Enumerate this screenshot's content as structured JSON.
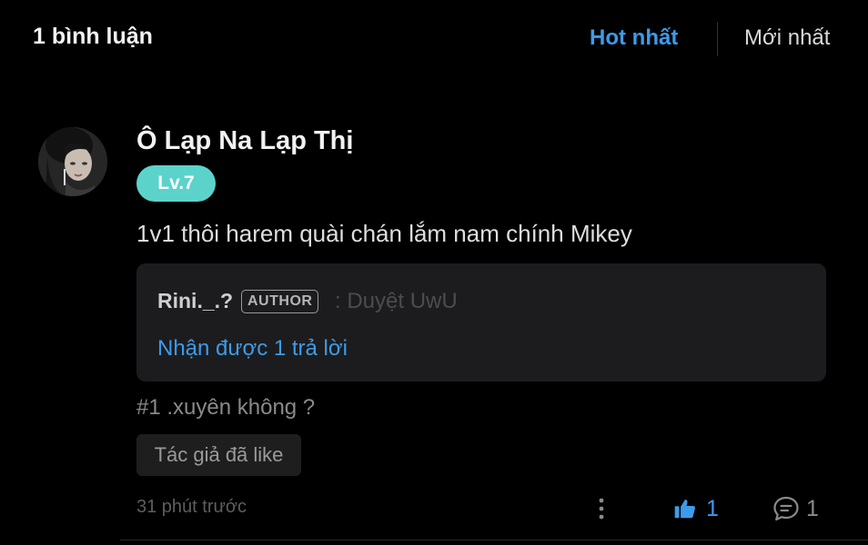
{
  "header": {
    "comment_count": "1 bình luận",
    "sort_hot": "Hot nhất",
    "sort_new": "Mới nhất"
  },
  "comment": {
    "username": "Ô Lạp Na Lạp Thị",
    "level": "Lv.7",
    "text": "1v1 thôi harem quài chán lắm nam chính Mikey",
    "reply": {
      "author": "Rini._.?",
      "author_tag": "AUTHOR",
      "text": ": Duyệt UwU",
      "reply_count": "Nhận được 1 trả lời"
    },
    "tag": "#1 .xuyên không ?",
    "author_liked": "Tác giả đã like",
    "timestamp": "31 phút trước",
    "likes": "1",
    "replies": "1"
  },
  "colors": {
    "accent": "#3d9be9",
    "level_badge": "#5bd3cb",
    "background": "#000000"
  },
  "icons": [
    "avatar",
    "more-vertical-icon",
    "thumbs-up-icon",
    "comment-bubble-icon"
  ]
}
